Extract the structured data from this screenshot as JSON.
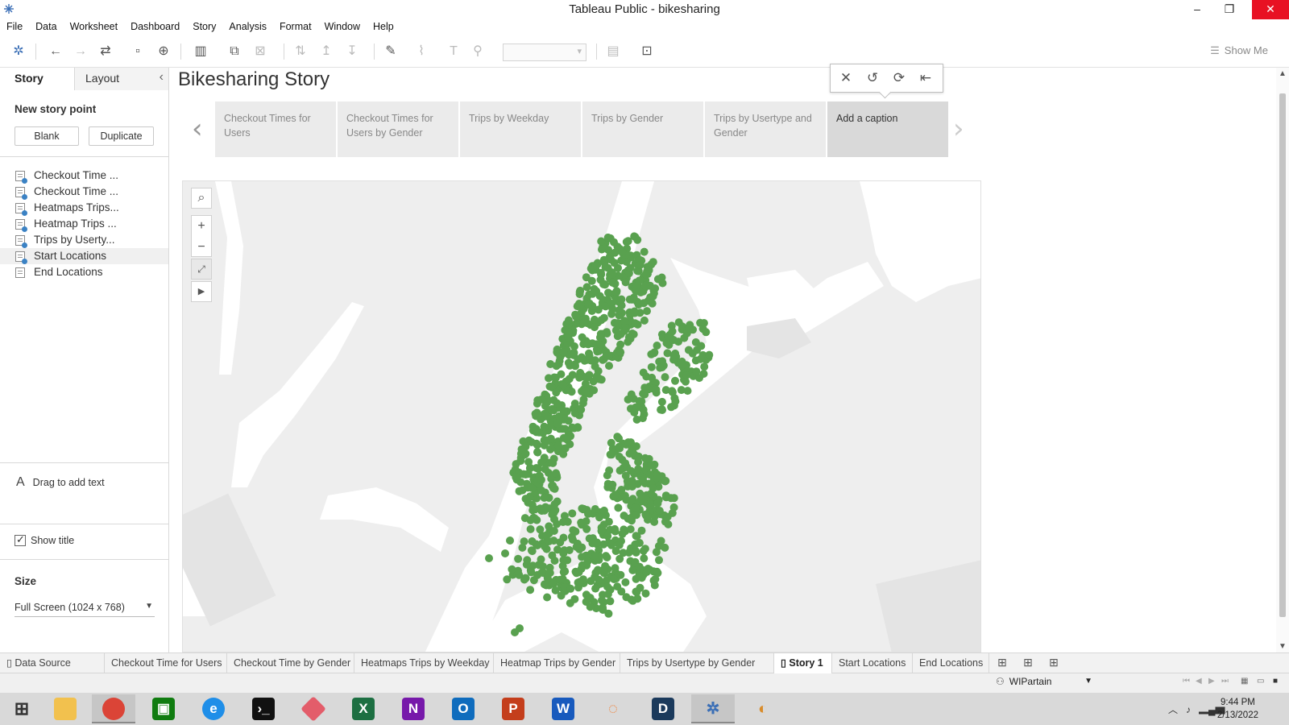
{
  "window": {
    "title": "Tableau Public - bikesharing"
  },
  "menu": [
    "File",
    "Data",
    "Worksheet",
    "Dashboard",
    "Story",
    "Analysis",
    "Format",
    "Window",
    "Help"
  ],
  "toolbar": {
    "show_me_label": "Show Me"
  },
  "left_pane": {
    "tab_story": "Story",
    "tab_layout": "Layout",
    "new_story_point": "New story point",
    "blank_button": "Blank",
    "duplicate_button": "Duplicate",
    "sheets": [
      {
        "label": "Checkout Time ...",
        "linked": true
      },
      {
        "label": "Checkout Time ...",
        "linked": true
      },
      {
        "label": "Heatmaps Trips...",
        "linked": true
      },
      {
        "label": "Heatmap Trips ...",
        "linked": true
      },
      {
        "label": "Trips by Userty...",
        "linked": true
      },
      {
        "label": "Start Locations",
        "linked": true,
        "selected": true
      },
      {
        "label": "End Locations",
        "linked": false
      }
    ],
    "drag_text": "Drag to add text",
    "show_title": "Show title",
    "size_label": "Size",
    "size_value": "Full Screen (1024 x 768)"
  },
  "story": {
    "title": "Bikesharing Story",
    "points": [
      {
        "caption": "Checkout Times for Users",
        "active": false
      },
      {
        "caption": "Checkout Times for Users by Gender",
        "active": false
      },
      {
        "caption": "Trips by Weekday",
        "active": false
      },
      {
        "caption": "Trips by Gender",
        "active": false
      },
      {
        "caption": "Trips by Usertype and Gender",
        "active": false
      },
      {
        "caption": "Add a caption",
        "active": true
      }
    ]
  },
  "map": {
    "point_color": "#59a14f",
    "background_color": "#eeeeee",
    "water_color": "#ffffff"
  },
  "sheet_tabs": {
    "data_source": "Data Source",
    "tabs": [
      {
        "label": "Checkout Time for Users"
      },
      {
        "label": "Checkout Time by Gender"
      },
      {
        "label": "Heatmaps Trips by Weekday"
      },
      {
        "label": "Heatmap Trips by Gender"
      },
      {
        "label": "Trips by Usertype by Gender"
      },
      {
        "label": "Story 1",
        "active": true
      },
      {
        "label": "Start Locations"
      },
      {
        "label": "End Locations"
      }
    ]
  },
  "status": {
    "user": "WIPartain"
  },
  "taskbar": {
    "time": "9:44 PM",
    "date": "2/13/2022"
  }
}
